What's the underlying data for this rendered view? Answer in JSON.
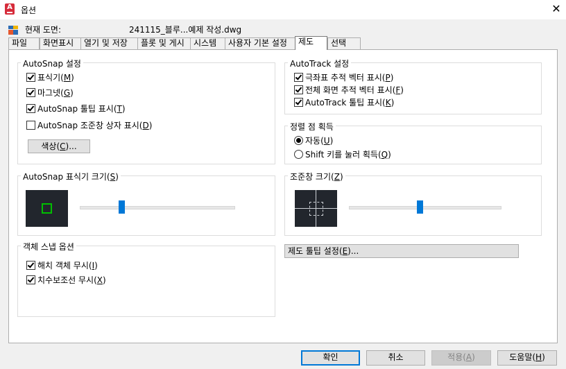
{
  "window": {
    "title": "옵션",
    "close_glyph": "✕",
    "app_icon_letter": "A"
  },
  "current_drawing": {
    "label": "현재 도면:",
    "value": "241115_블루...예제 작성.dwg"
  },
  "tabs": [
    {
      "label": "파일",
      "active": false
    },
    {
      "label": "화면표시",
      "active": false
    },
    {
      "label": "열기 및 저장",
      "active": false
    },
    {
      "label": "플롯 및 게시",
      "active": false
    },
    {
      "label": "시스템",
      "active": false
    },
    {
      "label": "사용자 기본 설정",
      "active": false
    },
    {
      "label": "제도",
      "active": true
    },
    {
      "label": "선택",
      "active": false
    }
  ],
  "autosnap_settings": {
    "title": "AutoSnap 설정",
    "options": [
      {
        "pre": "표식기(",
        "key": "M",
        "post": ")",
        "checked": true
      },
      {
        "pre": "마그넷(",
        "key": "G",
        "post": ")",
        "checked": true
      },
      {
        "pre": "AutoSnap 툴팁 표시(",
        "key": "T",
        "post": ")",
        "checked": true
      },
      {
        "pre": "AutoSnap 조준창 상자 표시(",
        "key": "D",
        "post": ")",
        "checked": false
      }
    ],
    "color_button": {
      "pre": "색상(",
      "key": "C",
      "post": ")..."
    }
  },
  "autotrack_settings": {
    "title": "AutoTrack 설정",
    "options": [
      {
        "pre": "극좌표 추적 벡터 표시(",
        "key": "P",
        "post": ")",
        "checked": true
      },
      {
        "pre": "전체 화면 추적 벡터 표시(",
        "key": "F",
        "post": ")",
        "checked": true
      },
      {
        "pre": "AutoTrack 툴팁 표시(",
        "key": "K",
        "post": ")",
        "checked": true
      }
    ]
  },
  "alignment_acquisition": {
    "title": "정렬 점 획득",
    "options": [
      {
        "pre": "자동(",
        "key": "U",
        "post": ")",
        "selected": true
      },
      {
        "pre": "Shift 키를 눌러 획득(",
        "key": "Q",
        "post": ")",
        "selected": false
      }
    ]
  },
  "marker_size": {
    "title_pre": "AutoSnap 표식기 크기(",
    "title_key": "S",
    "title_post": ")",
    "slider_fraction": 0.27,
    "marker_color": "#00c000"
  },
  "aperture_size": {
    "title_pre": "조준창 크기(",
    "title_key": "Z",
    "title_post": ")",
    "slider_fraction": 0.47
  },
  "object_snap_options": {
    "title": "객체 스냅 옵션",
    "options": [
      {
        "pre": "해치 객체 무시(",
        "key": "I",
        "post": ")",
        "checked": true
      },
      {
        "pre": "치수보조선 무시(",
        "key": "X",
        "post": ")",
        "checked": true
      }
    ]
  },
  "drafting_tooltip_button": {
    "pre": "제도 툴팁 설정(",
    "key": "E",
    "post": ")..."
  },
  "footer": {
    "ok": "확인",
    "cancel": "취소",
    "apply": {
      "pre": "적용(",
      "key": "A",
      "post": ")"
    },
    "help": {
      "pre": "도움말(",
      "key": "H",
      "post": ")"
    }
  },
  "colors": {
    "accent": "#0078d7",
    "app_icon": "#d62c3b",
    "preview_bg": "#22262d"
  }
}
